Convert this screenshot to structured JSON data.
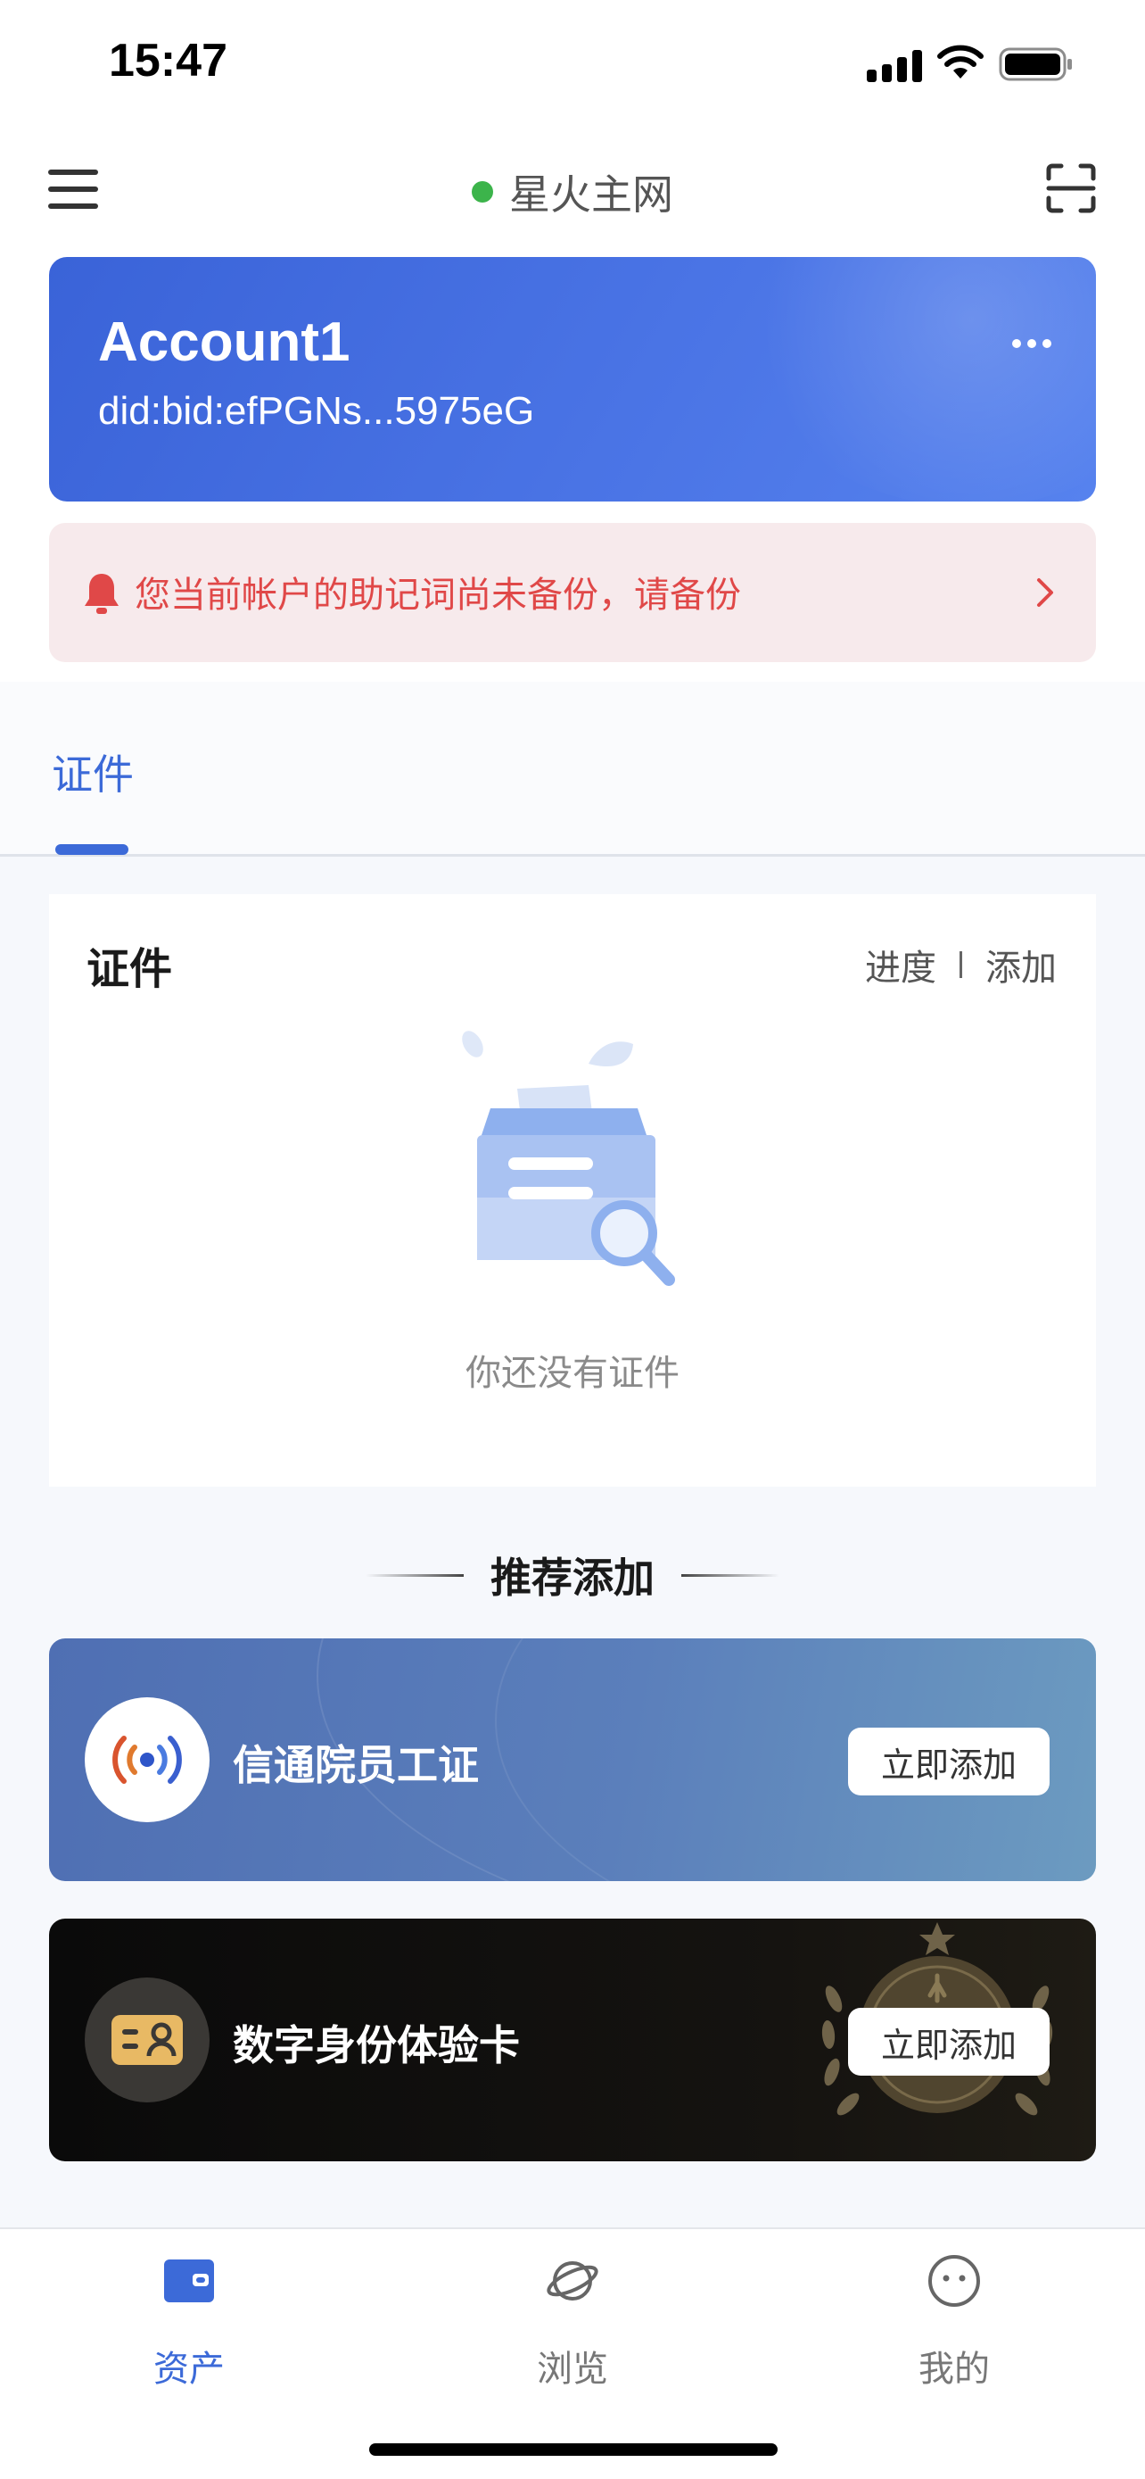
{
  "status_bar": {
    "time": "15:47"
  },
  "header": {
    "network": "星火主网"
  },
  "account": {
    "name": "Account1",
    "did": "did:bid:efPGNs...5975eG"
  },
  "notice": {
    "text": "您当前帐户的助记词尚未备份，请备份"
  },
  "tabs": [
    {
      "label": "证件",
      "active": true
    }
  ],
  "cert_panel": {
    "title": "证件",
    "actions": {
      "progress": "进度",
      "separator": "|",
      "add": "添加"
    },
    "empty_text": "你还没有证件"
  },
  "recommend": {
    "title": "推荐添加",
    "items": [
      {
        "name": "信通院员工证",
        "button": "立即添加"
      },
      {
        "name": "数字身份体验卡",
        "button": "立即添加"
      }
    ]
  },
  "bottom_nav": [
    {
      "label": "资产",
      "icon": "wallet-icon",
      "active": true
    },
    {
      "label": "浏览",
      "icon": "planet-icon",
      "active": false
    },
    {
      "label": "我的",
      "icon": "smiley-icon",
      "active": false
    }
  ],
  "colors": {
    "accent": "#3c6ad8",
    "network_status": "#3cb44b",
    "warning_text": "#e04848",
    "warning_bg": "#f7eaec"
  }
}
